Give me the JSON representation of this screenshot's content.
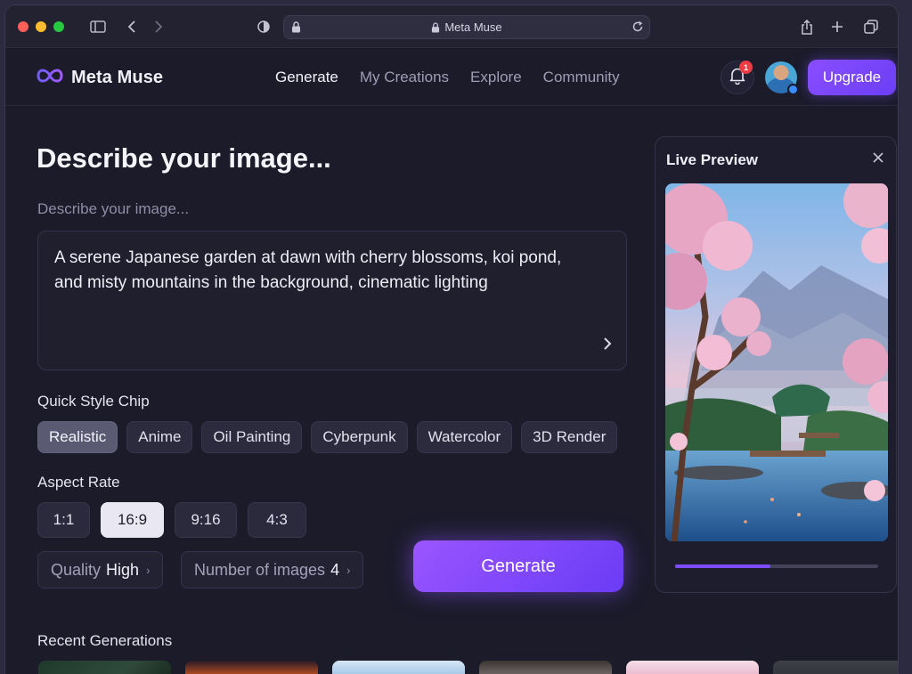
{
  "browser": {
    "url_title": "Meta Muse"
  },
  "brand": {
    "name": "Meta Muse",
    "accent": "#7c4dff"
  },
  "nav": {
    "links": [
      "Generate",
      "My Creations",
      "Explore",
      "Community"
    ],
    "active": "Generate",
    "notification_count": "1",
    "upgrade_label": "Upgrade"
  },
  "main": {
    "heading": "Describe your image...",
    "prompt_label": "Describe your image...",
    "prompt_text": "A serene Japanese garden at dawn with cherry blossoms, koi pond, and misty mountains in the background, cinematic lighting",
    "style_label": "Quick Style Chip",
    "styles": [
      "Realistic",
      "Anime",
      "Oil Painting",
      "Cyberpunk",
      "Watercolor",
      "3D Render"
    ],
    "style_selected": "Realistic",
    "aspect_label": "Aspect Rate",
    "ratios": [
      "1:1",
      "16:9",
      "9:16",
      "4:3"
    ],
    "ratio_selected": "16:9",
    "quality_label": "Quality",
    "quality_value": "High",
    "count_label": "Number of images",
    "count_value": "4",
    "generate_label": "Generate"
  },
  "preview": {
    "title": "Live Preview",
    "progress": 0.47
  },
  "recent": {
    "title": "Recent Generations"
  }
}
